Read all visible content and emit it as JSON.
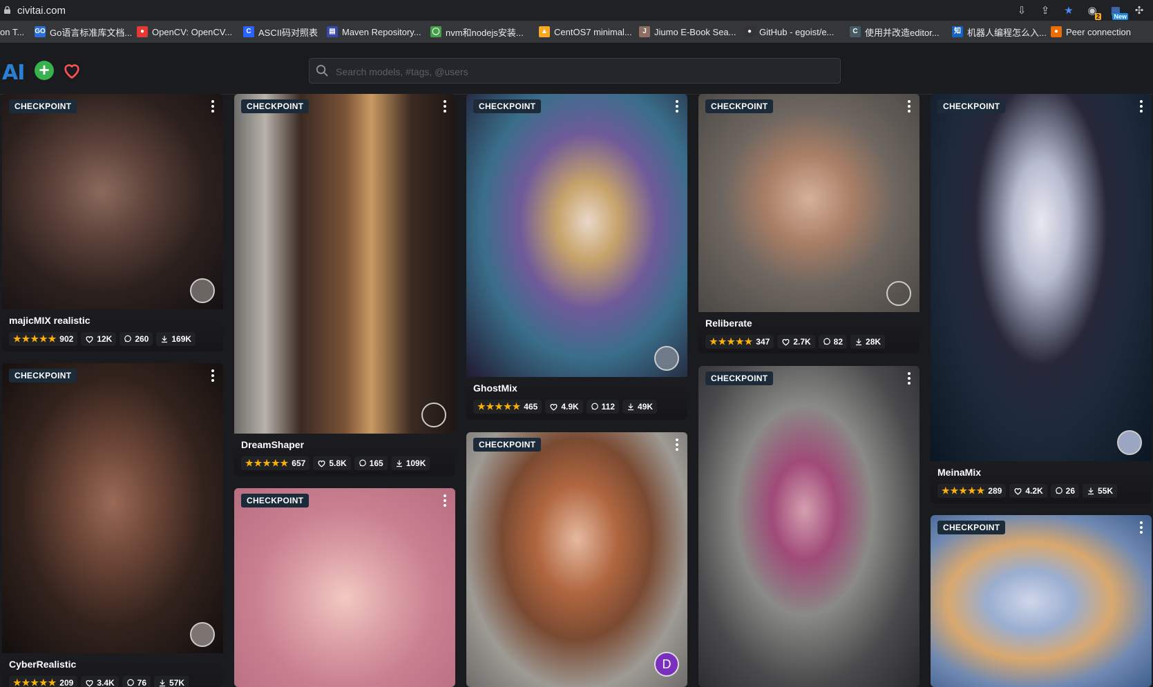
{
  "browser": {
    "url": "civitai.com",
    "bookmarks": [
      {
        "label": "on T...",
        "color": "#35363a",
        "fav": ""
      },
      {
        "label": "Go语言标准库文档...",
        "color": "#2b6fd6",
        "fav": "GO"
      },
      {
        "label": "OpenCV: OpenCV...",
        "color": "#e53935",
        "fav": "●"
      },
      {
        "label": "ASCII码对照表",
        "color": "#2962ff",
        "fav": "C"
      },
      {
        "label": "Maven Repository...",
        "color": "#3949ab",
        "fav": "▤"
      },
      {
        "label": "nvm和nodejs安装...",
        "color": "#43a047",
        "fav": "◯"
      },
      {
        "label": "CentOS7 minimal...",
        "color": "#f9a825",
        "fav": "▲"
      },
      {
        "label": "Jiumo E-Book Sea...",
        "color": "#8d6e63",
        "fav": "J"
      },
      {
        "label": "GitHub - egoist/e...",
        "color": "#333333",
        "fav": "●"
      },
      {
        "label": "使用并改造editor...",
        "color": "#455a64",
        "fav": "C"
      },
      {
        "label": "机器人编程怎么入...",
        "color": "#1565c0",
        "fav": "知"
      },
      {
        "label": "Peer connection",
        "color": "#ef6c00",
        "fav": "●"
      }
    ],
    "badge_number": "2",
    "badge_new": "New"
  },
  "app": {
    "logo": "AI",
    "add_label": "+",
    "search_placeholder": "Search models, #tags, @users"
  },
  "cards": [
    {
      "badge": "CHECKPOINT",
      "title": "majicMIX realistic",
      "rating": "902",
      "likes": "12K",
      "comments": "260",
      "downloads": "169K"
    },
    {
      "badge": "CHECKPOINT",
      "title": "CyberRealistic",
      "rating": "209",
      "likes": "3.4K",
      "comments": "76",
      "downloads": "57K"
    },
    {
      "badge": "CHECKPOINT",
      "title": "DreamShaper",
      "rating": "657",
      "likes": "5.8K",
      "comments": "165",
      "downloads": "109K"
    },
    {
      "badge": "CHECKPOINT",
      "title": "",
      "rating": "",
      "likes": "",
      "comments": "",
      "downloads": ""
    },
    {
      "badge": "CHECKPOINT",
      "title": "GhostMix",
      "rating": "465",
      "likes": "4.9K",
      "comments": "112",
      "downloads": "49K"
    },
    {
      "badge": "CHECKPOINT",
      "title": "",
      "rating": "",
      "likes": "",
      "comments": "",
      "downloads": "",
      "avatar_letter": "D"
    },
    {
      "badge": "CHECKPOINT",
      "title": "Reliberate",
      "rating": "347",
      "likes": "2.7K",
      "comments": "82",
      "downloads": "28K"
    },
    {
      "badge": "CHECKPOINT",
      "title": "",
      "rating": "",
      "likes": "",
      "comments": "",
      "downloads": ""
    },
    {
      "badge": "CHECKPOINT",
      "title": "MeinaMix",
      "rating": "289",
      "likes": "4.2K",
      "comments": "26",
      "downloads": "55K"
    },
    {
      "badge": "CHECKPOINT",
      "title": "",
      "rating": "",
      "likes": "",
      "comments": "",
      "downloads": ""
    }
  ],
  "colors": {
    "accent": "#2a7fd4",
    "add_green": "#37b24d",
    "heart_red": "#fa5252",
    "star": "#fab005"
  }
}
